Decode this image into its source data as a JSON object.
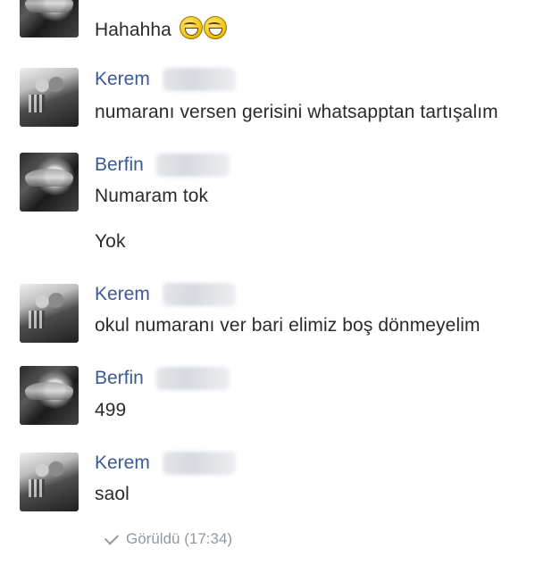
{
  "messages": [
    {
      "sender": "",
      "text": "Hahahha"
    },
    {
      "sender": "Kerem",
      "text": "numaranı versen gerisini whatsapptan tartışalım"
    },
    {
      "sender": "Berfin",
      "text": "Numaram tok"
    },
    {
      "sender": "",
      "text": "Yok"
    },
    {
      "sender": "Kerem",
      "text": "okul numaranı ver bari elimiz boş dönmeyelim"
    },
    {
      "sender": "Berfin",
      "text": "499"
    },
    {
      "sender": "Kerem",
      "text": "saol"
    }
  ],
  "emojis": [
    "grinning-sweat-emoji",
    "grinning-sweat-emoji"
  ],
  "seen_status": "Görüldü (17:34)",
  "colors": {
    "sender_name": "#3b5998",
    "message_text": "#2b2b2b",
    "seen_text": "#9197a3"
  }
}
